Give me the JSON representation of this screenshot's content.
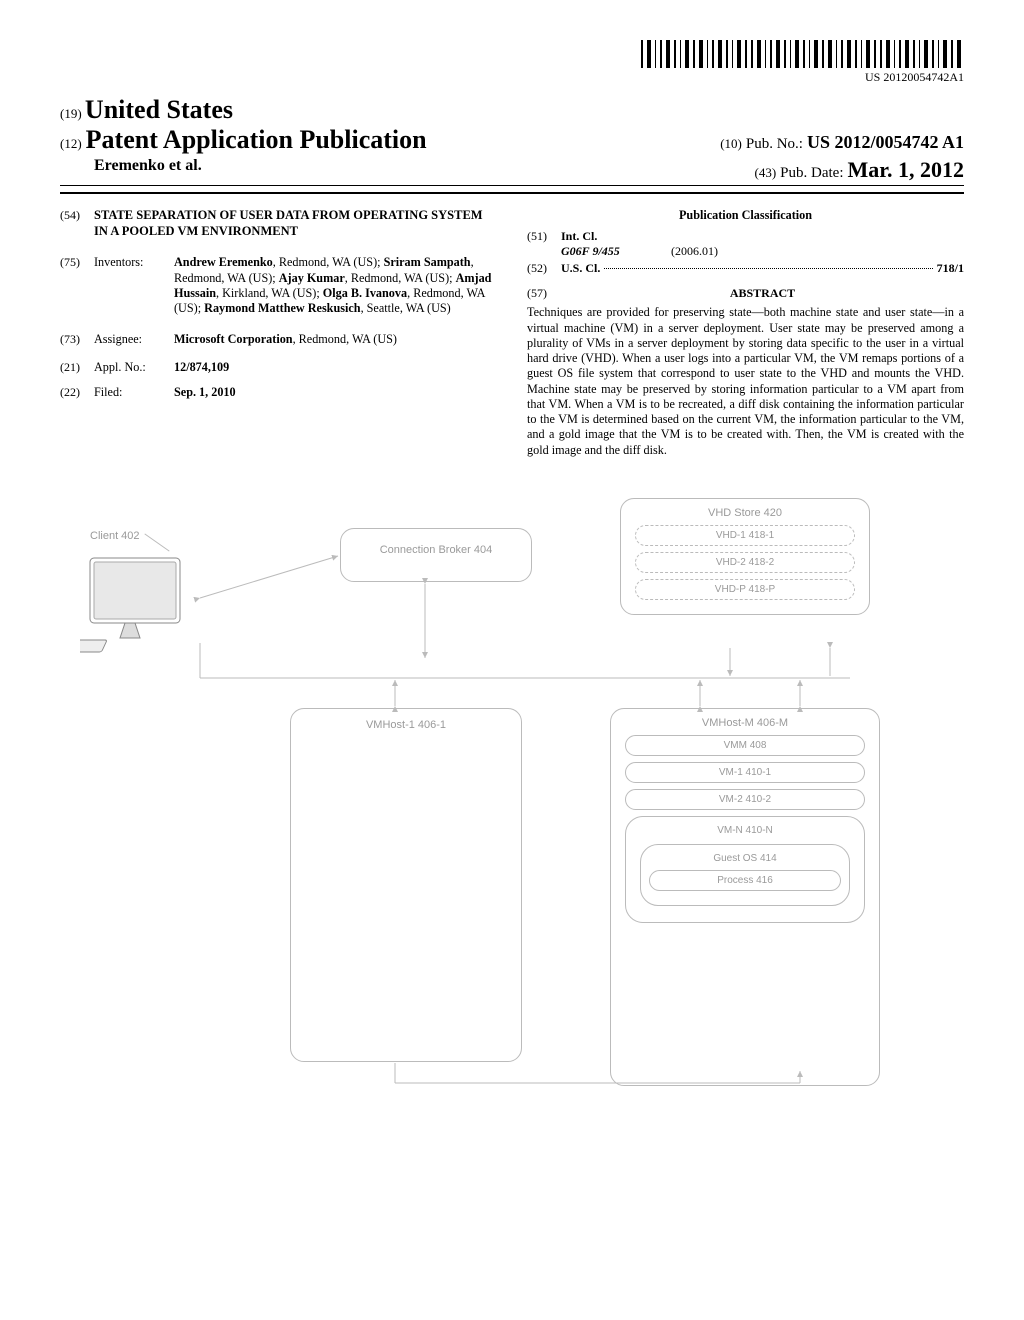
{
  "doc_number_header": "US 20120054742A1",
  "code19": "(19)",
  "country": "United States",
  "code12": "(12)",
  "pub_type": "Patent Application Publication",
  "code10": "(10)",
  "pub_no_label": "Pub. No.:",
  "pub_no": "US 2012/0054742 A1",
  "author_line": "Eremenko et al.",
  "code43": "(43)",
  "pub_date_label": "Pub. Date:",
  "pub_date": "Mar. 1, 2012",
  "left": {
    "code54": "(54)",
    "title": "STATE SEPARATION OF USER DATA FROM OPERATING SYSTEM IN A POOLED VM ENVIRONMENT",
    "code75": "(75)",
    "inventors_label": "Inventors:",
    "inventors": "Andrew Eremenko, Redmond, WA (US); Sriram Sampath, Redmond, WA (US); Ajay Kumar, Redmond, WA (US); Amjad Hussain, Kirkland, WA (US); Olga B. Ivanova, Redmond, WA (US); Raymond Matthew Reskusich, Seattle, WA (US)",
    "code73": "(73)",
    "assignee_label": "Assignee:",
    "assignee": "Microsoft Corporation, Redmond, WA (US)",
    "code21": "(21)",
    "appl_label": "Appl. No.:",
    "appl_no": "12/874,109",
    "code22": "(22)",
    "filed_label": "Filed:",
    "filed": "Sep. 1, 2010"
  },
  "right": {
    "pub_class_header": "Publication Classification",
    "code51": "(51)",
    "intcl_label": "Int. Cl.",
    "intcl_code": "G06F 9/455",
    "intcl_year": "(2006.01)",
    "code52": "(52)",
    "uscl_label": "U.S. Cl.",
    "uscl_value": "718/1",
    "code57": "(57)",
    "abstract_header": "ABSTRACT",
    "abstract": "Techniques are provided for preserving state—both machine state and user state—in a virtual machine (VM) in a server deployment. User state may be preserved among a plurality of VMs in a server deployment by storing data specific to the user in a virtual hard drive (VHD). When a user logs into a particular VM, the VM remaps portions of a guest OS file system that correspond to user state to the VHD and mounts the VHD. Machine state may be preserved by storing information particular to a VM apart from that VM. When a VM is to be recreated, a diff disk containing the information particular to the VM is determined based on the current VM, the information particular to the VM, and a gold image that the VM is to be created with. Then, the VM is created with the gold image and the diff disk."
  },
  "figure": {
    "client": "Client 402",
    "broker": "Connection Broker 404",
    "vhd_store": "VHD Store 420",
    "vhd1": "VHD-1 418-1",
    "vhd2": "VHD-2 418-2",
    "vhdp": "VHD-P 418-P",
    "vmhost1": "VMHost-1 406-1",
    "vmhostm": "VMHost-M 406-M",
    "vmm": "VMM 408",
    "vm1": "VM-1 410-1",
    "vm2": "VM-2 410-2",
    "vmn": "VM-N 410-N",
    "guestos": "Guest OS 414",
    "process": "Process 416"
  }
}
